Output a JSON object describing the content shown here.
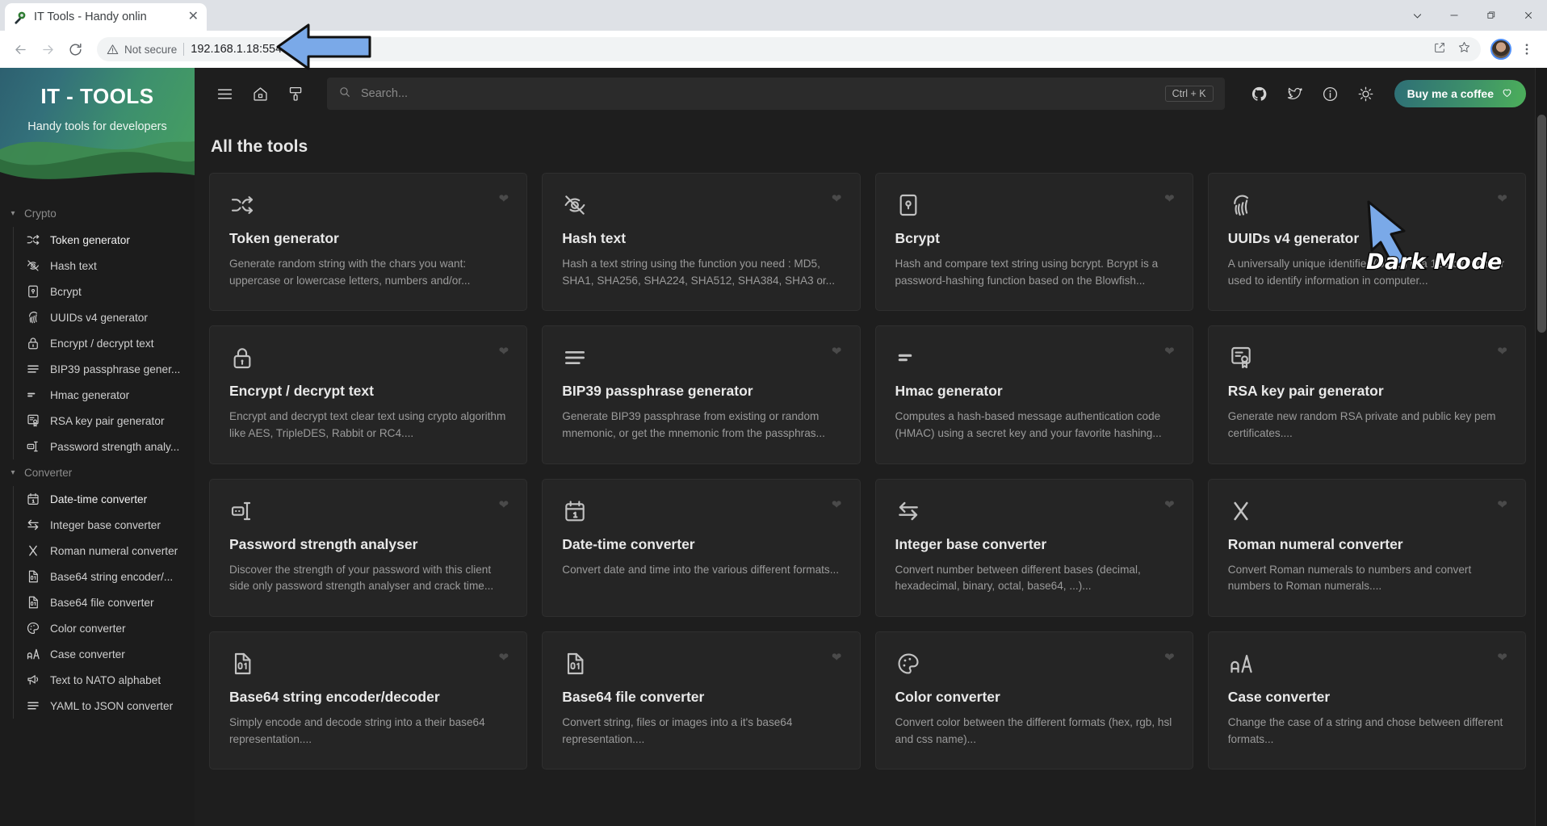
{
  "browser": {
    "tab": {
      "title": "IT Tools - Handy onlin",
      "close_label": "✕",
      "favicon": "wrench-gear-icon"
    },
    "window_controls": [
      {
        "name": "tab-search-button",
        "glyph": "⌄"
      },
      {
        "name": "minimize-button",
        "glyph": "—"
      },
      {
        "name": "restore-button",
        "glyph": "❐"
      },
      {
        "name": "close-window-button",
        "glyph": "✕"
      }
    ],
    "nav": {
      "back": "back-button",
      "forward": "forward-button",
      "reload": "reload-button"
    },
    "omnibox": {
      "security_label": "Not secure",
      "url": "192.168.1.18:5545",
      "share_icon": "share-icon",
      "bookmark_icon": "star-icon"
    },
    "profile": "profile-avatar",
    "menu": "⋮"
  },
  "annotations": [
    {
      "name": "url-arrow",
      "kind": "arrow-left",
      "color": "#7aa9e8"
    },
    {
      "name": "dark-mode-arrow",
      "kind": "arrow-up-left",
      "color": "#7aa9e8"
    },
    {
      "name": "dark-mode-label",
      "text": "Dark Mode"
    }
  ],
  "sidebar": {
    "brand_title": "IT - TOOLS",
    "brand_subtitle": "Handy tools for developers",
    "groups": [
      {
        "label": "Crypto",
        "items": [
          {
            "icon": "shuffle-icon",
            "label": "Token generator",
            "active": true
          },
          {
            "icon": "eye-off-icon",
            "label": "Hash text",
            "active": false
          },
          {
            "icon": "lock-square-icon",
            "label": "Bcrypt",
            "active": false
          },
          {
            "icon": "fingerprint-icon",
            "label": "UUIDs v4 generator",
            "active": false
          },
          {
            "icon": "padlock-icon",
            "label": "Encrypt / decrypt text",
            "active": false
          },
          {
            "icon": "lines-icon",
            "label": "BIP39 passphrase gener...",
            "active": false
          },
          {
            "icon": "hmac-icon",
            "label": "Hmac generator",
            "active": false
          },
          {
            "icon": "certificate-icon",
            "label": "RSA key pair generator",
            "active": false
          },
          {
            "icon": "password-meter-icon",
            "label": "Password strength analy...",
            "active": false
          }
        ]
      },
      {
        "label": "Converter",
        "items": [
          {
            "icon": "calendar-icon",
            "label": "Date-time converter",
            "active": true
          },
          {
            "icon": "arrows-exchange-icon",
            "label": "Integer base converter",
            "active": false
          },
          {
            "icon": "roman-x-icon",
            "label": "Roman numeral converter",
            "active": false
          },
          {
            "icon": "file-binary-icon",
            "label": "Base64 string encoder/...",
            "active": false
          },
          {
            "icon": "file-binary-icon",
            "label": "Base64 file converter",
            "active": false
          },
          {
            "icon": "palette-icon",
            "label": "Color converter",
            "active": false
          },
          {
            "icon": "case-aa-icon",
            "label": "Case converter",
            "active": false
          },
          {
            "icon": "megaphone-icon",
            "label": "Text to NATO alphabet",
            "active": false
          },
          {
            "icon": "lines-icon",
            "label": "YAML to JSON converter",
            "active": false
          }
        ]
      }
    ]
  },
  "topbar": {
    "menu_icon": "hamburger-menu-icon",
    "home_icon": "home-icon",
    "theme_icon": "paint-brush-icon",
    "search": {
      "placeholder": "Search...",
      "shortcut": "Ctrl + K",
      "icon": "search-icon"
    },
    "icons": [
      {
        "name": "github-icon",
        "title": "GitHub"
      },
      {
        "name": "twitter-icon",
        "title": "Twitter"
      },
      {
        "name": "info-icon",
        "title": "About"
      },
      {
        "name": "sun-icon",
        "title": "Dark mode toggle"
      }
    ],
    "coffee_button": {
      "label": "Buy me a coffee",
      "icon": "heart-icon"
    }
  },
  "main": {
    "section_title": "All the tools",
    "favorite_icon": "heart-icon",
    "cards": [
      {
        "icon": "shuffle-icon",
        "title": "Token generator",
        "desc": "Generate random string with the chars you want: uppercase or lowercase letters, numbers and/or..."
      },
      {
        "icon": "eye-off-icon",
        "title": "Hash text",
        "desc": "Hash a text string using the function you need : MD5, SHA1, SHA256, SHA224, SHA512, SHA384, SHA3 or..."
      },
      {
        "icon": "lock-square-icon",
        "title": "Bcrypt",
        "desc": "Hash and compare text string using bcrypt. Bcrypt is a password-hashing function based on the Blowfish..."
      },
      {
        "icon": "fingerprint-icon",
        "title": "UUIDs v4 generator",
        "desc": "A universally unique identifier (UUID) is a 128-bit number used to identify information in computer..."
      },
      {
        "icon": "padlock-icon",
        "title": "Encrypt / decrypt text",
        "desc": "Encrypt and decrypt text clear text using crypto algorithm like AES, TripleDES, Rabbit or RC4...."
      },
      {
        "icon": "lines-icon",
        "title": "BIP39 passphrase generator",
        "desc": "Generate BIP39 passphrase from existing or random mnemonic, or get the mnemonic from the passphras..."
      },
      {
        "icon": "hmac-icon",
        "title": "Hmac generator",
        "desc": "Computes a hash-based message authentication code (HMAC) using a secret key and your favorite hashing..."
      },
      {
        "icon": "certificate-icon",
        "title": "RSA key pair generator",
        "desc": "Generate new random RSA private and public key pem certificates...."
      },
      {
        "icon": "password-meter-icon",
        "title": "Password strength analyser",
        "desc": "Discover the strength of your password with this client side only password strength analyser and crack time..."
      },
      {
        "icon": "calendar-icon",
        "title": "Date-time converter",
        "desc": "Convert date and time into the various different formats..."
      },
      {
        "icon": "arrows-exchange-icon",
        "title": "Integer base converter",
        "desc": "Convert number between different bases (decimal, hexadecimal, binary, octal, base64, ...)..."
      },
      {
        "icon": "roman-x-icon",
        "title": "Roman numeral converter",
        "desc": "Convert Roman numerals to numbers and convert numbers to Roman numerals...."
      },
      {
        "icon": "file-binary-icon",
        "title": "Base64 string encoder/decoder",
        "desc": "Simply encode and decode string into a their base64 representation...."
      },
      {
        "icon": "file-binary-icon",
        "title": "Base64 file converter",
        "desc": "Convert string, files or images into a it's base64 representation...."
      },
      {
        "icon": "palette-icon",
        "title": "Color converter",
        "desc": "Convert color between the different formats (hex, rgb, hsl and css name)..."
      },
      {
        "icon": "case-aa-icon",
        "title": "Case converter",
        "desc": "Change the case of a string and chose between different formats..."
      }
    ]
  },
  "colors": {
    "page_bg": "#1e1e1e",
    "card_bg": "#252525",
    "sidebar_bg": "#1c1c1c",
    "accent_green": "#4caf5a",
    "brand_gradient_start": "#2d6070",
    "brand_gradient_end": "#47a15f",
    "annotation_arrow": "#7aa9e8"
  }
}
